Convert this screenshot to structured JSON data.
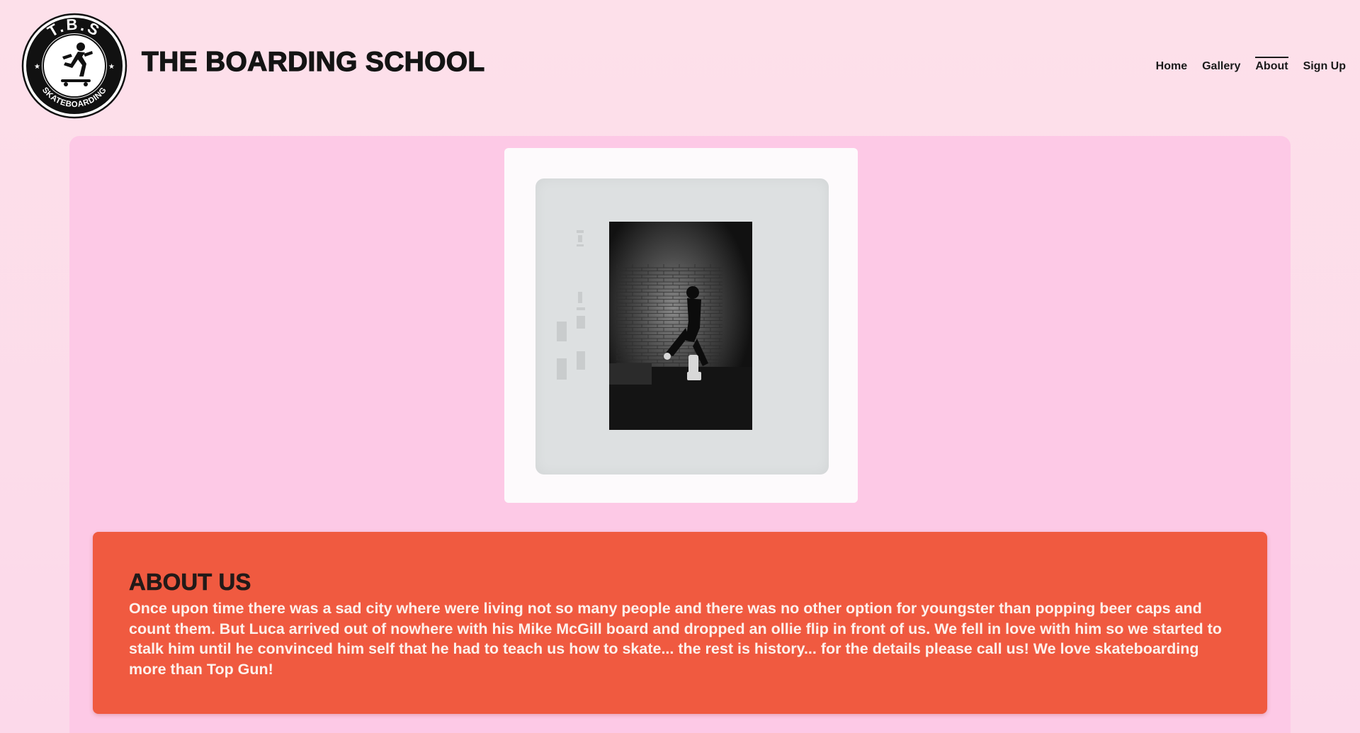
{
  "header": {
    "logo": {
      "top_text": "T.B.S",
      "bottom_text": "SKATEBOARDING",
      "icon": "skateboarder-icon"
    },
    "title": "THE BOARDING SCHOOL",
    "nav": [
      {
        "label": "Home",
        "active": false
      },
      {
        "label": "Gallery",
        "active": false
      },
      {
        "label": "About",
        "active": true
      },
      {
        "label": "Sign Up",
        "active": false
      }
    ]
  },
  "main": {
    "photo": {
      "icon": "skater-film-photo"
    },
    "about": {
      "title": "ABOUT US",
      "text": "Once upon time there was a sad city where were living not so many people and there was no other option for youngster than popping beer caps and count them. But Luca arrived out of nowhere with his Mike McGill board and dropped an ollie flip in front of us. We fell in love with him so we started to stalk him until he convinced him self that he had to teach us how to skate... the rest is history... for the details please call us! We love skateboarding more than Top Gun!"
    }
  },
  "colors": {
    "page_background": "#fde0ec",
    "panel_background": "#fdc9e6",
    "about_card": "#f05a40",
    "title_text": "#141414"
  }
}
